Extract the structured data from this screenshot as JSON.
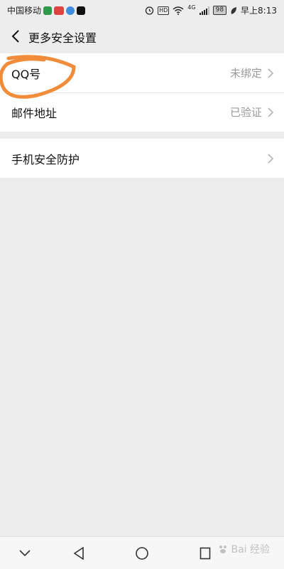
{
  "status_bar": {
    "carrier": "中国移动",
    "battery": "98",
    "signal_label": "4G",
    "hd_label": "HD",
    "time": "早上8:13"
  },
  "header": {
    "title": "更多安全设置"
  },
  "groups": [
    {
      "rows": [
        {
          "label": "QQ号",
          "value": "未绑定"
        },
        {
          "label": "邮件地址",
          "value": "已验证"
        }
      ]
    },
    {
      "rows": [
        {
          "label": "手机安全防护",
          "value": ""
        }
      ]
    }
  ],
  "annotation": {
    "color": "#f08c3a"
  },
  "watermark": {
    "text": "Bai 经验"
  }
}
